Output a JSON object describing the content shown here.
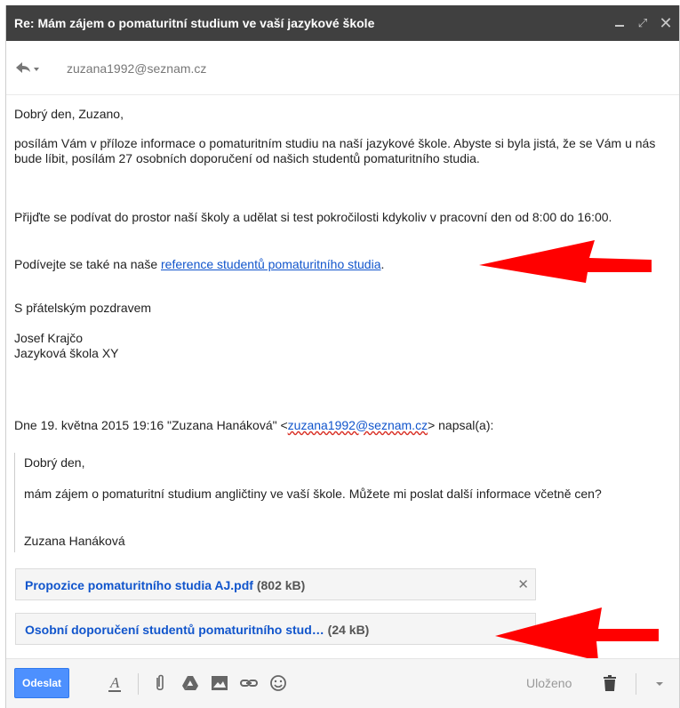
{
  "window": {
    "title": "Re: Mám zájem o pomaturitní studium ve vaší jazykové škole",
    "controls": {
      "minimize": "minimize-icon",
      "expand": "expand-icon",
      "close": "close-icon"
    }
  },
  "header": {
    "recipient": "zuzana1992@seznam.cz"
  },
  "message": {
    "greeting": "Dobrý den, Zuzano,",
    "para1": "posílám Vám v příloze informace o pomaturitním studiu na naší jazykové škole. Abyste si byla jistá, že se Vám u nás bude líbit, posílám 27 osobních doporučení od našich studentů pomaturitního studia.",
    "para2": "Přijďte se podívat do prostor naší školy a udělat si test pokročilosti kdykoliv v pracovní den od 8:00 do 16:00.",
    "para3_prefix": "Podívejte se také na naše ",
    "para3_link": "reference studentů pomaturitního studia",
    "para3_suffix": ".",
    "closing": "S přátelským pozdravem",
    "signature_name": "Josef Krajčo",
    "signature_company": "Jazyková škola XY"
  },
  "quote": {
    "attribution_prefix": "Dne 19. května 2015 19:16 \"Zuzana Hanáková\" <",
    "attribution_email": "zuzana1992@seznam.cz",
    "attribution_suffix": "> napsal(a):",
    "greeting": "Dobrý den,",
    "body": "mám zájem o pomaturitní studium angličtiny ve vaší škole. Můžete mi poslat další informace včetně cen?",
    "name": "Zuzana Hanáková"
  },
  "attachments": [
    {
      "name": "Propozice pomaturitního studia AJ.pdf",
      "size": "(802 kB)"
    },
    {
      "name": "Osobní doporučení studentů pomaturitního stud…",
      "size": "(24 kB)"
    }
  ],
  "toolbar": {
    "send_label": "Odeslat",
    "saved_label": "Uloženo"
  },
  "colors": {
    "title_bar": "#404040",
    "send_button": "#4d90fe",
    "link": "#1155cc",
    "arrow": "#ff0000"
  }
}
